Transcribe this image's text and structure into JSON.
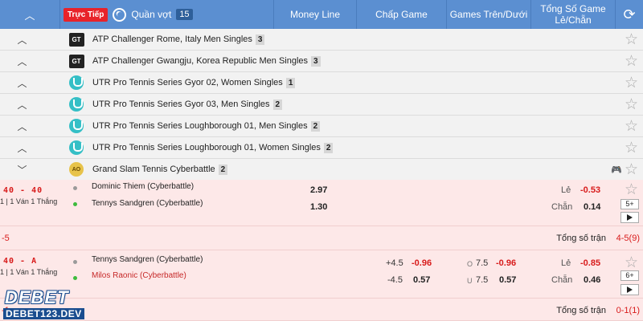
{
  "header": {
    "live_label": "Trực Tiếp",
    "sport_label": "Quần vợt",
    "sport_count": "15",
    "col_moneyline": "Money Line",
    "col_handicap": "Chấp Game",
    "col_overunder": "Games Trên/Dưới",
    "col_total_line1": "Tổng Số Game",
    "col_total_line2": "Lẻ/Chẵn"
  },
  "leagues": [
    {
      "name": "ATP Challenger Rome, Italy Men Singles",
      "count": "3",
      "logo": "GT"
    },
    {
      "name": "ATP Challenger Gwangju, Korea Republic Men Singles",
      "count": "3",
      "logo": "GT"
    },
    {
      "name": "UTR Pro Tennis Series Gyor 02, Women Singles",
      "count": "1",
      "logo": "UTR"
    },
    {
      "name": "UTR Pro Tennis Series Gyor 03, Men Singles",
      "count": "2",
      "logo": "UTR"
    },
    {
      "name": "UTR Pro Tennis Series Loughborough 01, Men Singles",
      "count": "2",
      "logo": "UTR"
    },
    {
      "name": "UTR Pro Tennis Series Loughborough 01, Women Singles",
      "count": "2",
      "logo": "UTR"
    },
    {
      "name": "Grand Slam Tennis Cyberbattle",
      "count": "2",
      "logo": "AO"
    }
  ],
  "matches": [
    {
      "score": "40 - 40",
      "status": "1 | 1 Ván 1 Thắng",
      "team1": "Dominic Thiem (Cyberbattle)",
      "team2": "Tennys Sandgren (Cyberbattle)",
      "ml1": "2.97",
      "ml2": "1.30",
      "odd_label": "Lẻ",
      "odd_value": "-0.53",
      "even_label": "Chẵn",
      "even_value": "0.14",
      "more": "5+"
    },
    {
      "score": "40 - A",
      "status": "1 | 1 Ván 1 Thắng",
      "team1": "Tennys Sandgren (Cyberbattle)",
      "team2": "Milos Raonic (Cyberbattle)",
      "hc1_line": "+4.5",
      "hc1_val": "-0.96",
      "hc2_line": "-4.5",
      "hc2_val": "0.57",
      "ou1_tag": "O",
      "ou1_line": "7.5",
      "ou1_val": "-0.96",
      "ou2_tag": "U",
      "ou2_line": "7.5",
      "ou2_val": "0.57",
      "odd_label": "Lẻ",
      "odd_value": "-0.85",
      "even_label": "Chẵn",
      "even_value": "0.46",
      "more": "6+"
    }
  ],
  "totals": [
    {
      "left": "-5",
      "label": "Tổng số trận",
      "value": "4-5(9)"
    },
    {
      "left": "-1",
      "label": "Tổng số trận",
      "value": "0-1(1)"
    }
  ],
  "watermark": {
    "brand": "DEBET",
    "site": "DEBET123.DEV"
  }
}
